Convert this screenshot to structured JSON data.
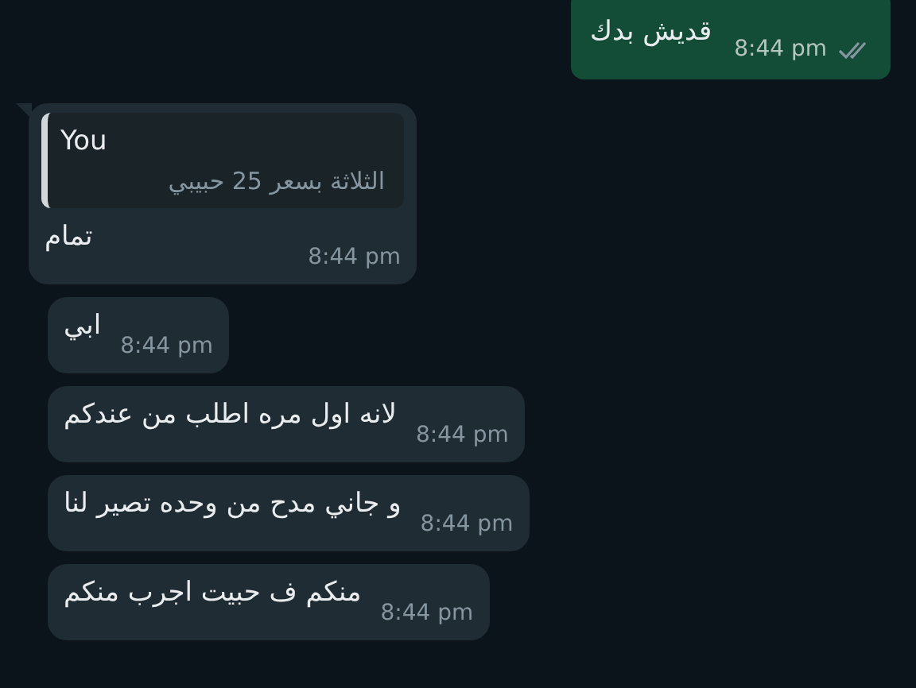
{
  "messages": [
    {
      "kind": "outgoing",
      "text": "قديش بدك",
      "time": "8:44 pm",
      "read": false
    },
    {
      "kind": "reply",
      "quote_author": "You",
      "quote_text": "الثلاثة بسعر 25 حبيبي",
      "text": "تمام",
      "time": "8:44 pm",
      "tail": true
    },
    {
      "kind": "incoming",
      "text": "ابي",
      "time": "8:44 pm",
      "tail": false
    },
    {
      "kind": "incoming",
      "text": "لانه اول مره اطلب من عندكم",
      "time": "8:44 pm",
      "tail": false
    },
    {
      "kind": "incoming",
      "text": "و جاني مدح من وحده تصير لنا",
      "time": "8:44 pm",
      "tail": false
    },
    {
      "kind": "incoming",
      "text": "منكم ف حبيت اجرب منكم",
      "time": "8:44 pm",
      "tail": false
    }
  ]
}
